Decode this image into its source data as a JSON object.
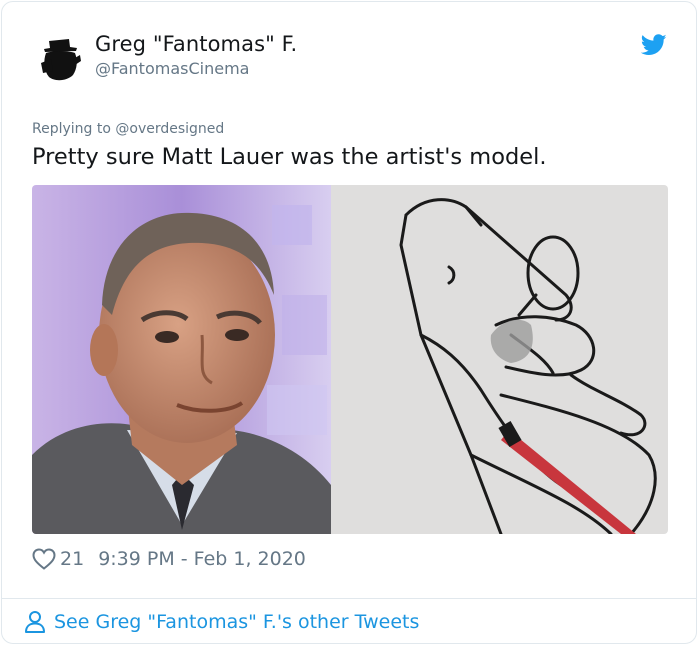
{
  "tweet": {
    "author_name": "Greg \"Fantomas\" F.",
    "author_handle": "@FantomasCinema",
    "replying_prefix": "Replying to",
    "replying_to": "@overdesigned",
    "text": "Pretty sure Matt Lauer was the artist's model.",
    "likes": "21",
    "timestamp": "9:39 PM - Feb 1, 2020",
    "footer_link": "See Greg \"Fantomas\" F.'s other Tweets"
  },
  "icons": {
    "avatar": "masked-figure-avatar",
    "brand": "twitter-bird-icon",
    "like": "heart-outline-icon",
    "profile": "person-outline-icon"
  },
  "colors": {
    "brand_blue": "#1da1f2",
    "link_blue": "#1b95e0",
    "secondary_text": "#657786",
    "divider": "#e1e8ed"
  }
}
